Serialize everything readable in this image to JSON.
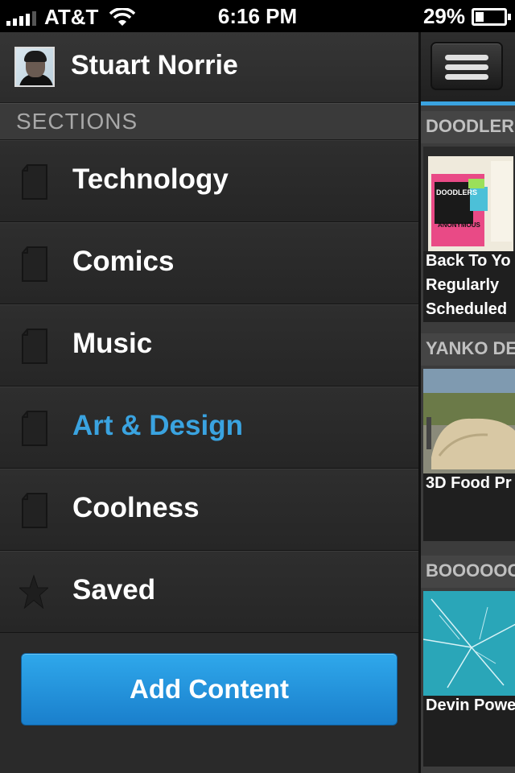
{
  "status_bar": {
    "carrier": "AT&T",
    "time": "6:16 PM",
    "battery_text": "29%",
    "battery_level": 0.29
  },
  "profile": {
    "name": "Stuart Norrie"
  },
  "sections_header": "SECTIONS",
  "menu_items": [
    {
      "label": "Technology",
      "icon": "page-icon"
    },
    {
      "label": "Comics",
      "icon": "page-icon"
    },
    {
      "label": "Music",
      "icon": "page-icon"
    },
    {
      "label": "Art & Design",
      "icon": "page-icon",
      "active": true
    },
    {
      "label": "Coolness",
      "icon": "page-icon"
    },
    {
      "label": "Saved",
      "icon": "star-icon"
    }
  ],
  "add_content_label": "Add Content",
  "accent_color": "#3aa3e0",
  "feed": {
    "cards": [
      {
        "header": "DOODLER",
        "caption_lines": [
          "Back To Yo",
          "Regularly",
          "Scheduled"
        ]
      },
      {
        "header": "YANKO DE",
        "caption_lines": [
          "3D Food Pr"
        ]
      },
      {
        "header": "BOOOOOC",
        "caption_lines": [
          "Devin Powe"
        ]
      }
    ]
  }
}
